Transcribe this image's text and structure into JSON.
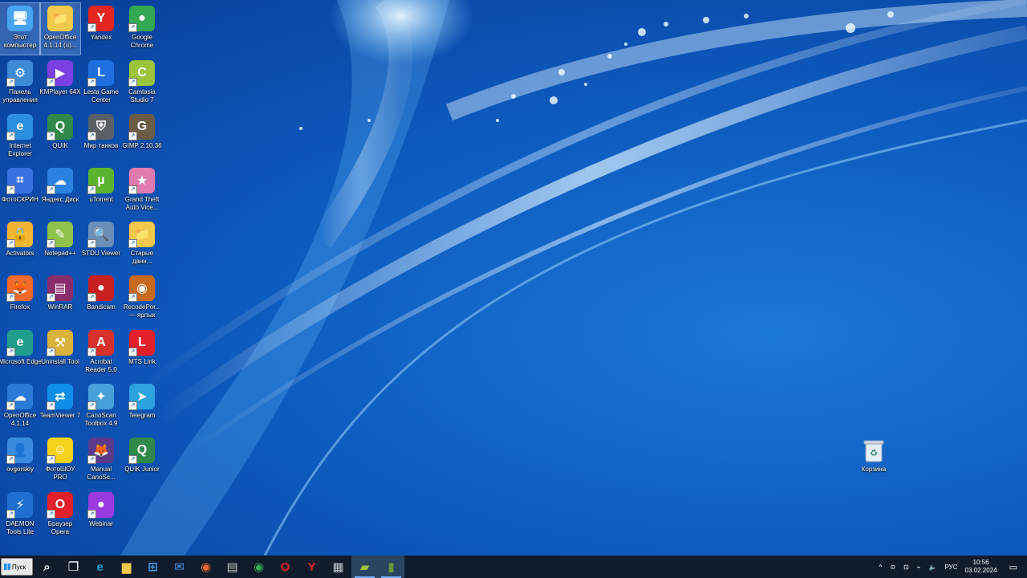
{
  "desktop_icons": [
    {
      "label": "Этот компьютер",
      "icon": "computer-icon",
      "color": "#4aa3f0",
      "glyph": "🖥",
      "selected": true
    },
    {
      "label": "OpenOffice 4.1.14 (u)...",
      "icon": "folder-icon",
      "color": "#f2c94c",
      "glyph": "📁",
      "selected": true
    },
    {
      "label": "Yandex",
      "icon": "yandex-browser-icon",
      "color": "#e52620",
      "glyph": "Y"
    },
    {
      "label": "Google Chrome",
      "icon": "chrome-icon",
      "color": "#34a853",
      "glyph": "●"
    },
    {
      "label": "Панель управления",
      "icon": "control-panel-icon",
      "color": "#3c8ad8",
      "glyph": "⚙"
    },
    {
      "label": "KMPlayer 64X",
      "icon": "kmplayer-icon",
      "color": "#7b3fe4",
      "glyph": "▶"
    },
    {
      "label": "Lesta Game Center",
      "icon": "lesta-icon",
      "color": "#1f6fe0",
      "glyph": "L"
    },
    {
      "label": "Camtasia Studio 7",
      "icon": "camtasia-icon",
      "color": "#9bc43a",
      "glyph": "C"
    },
    {
      "label": "Internet Explorer",
      "icon": "ie-icon",
      "color": "#2b8fe0",
      "glyph": "e"
    },
    {
      "label": "QUIK",
      "icon": "quik-icon",
      "color": "#2f8a4a",
      "glyph": "Q"
    },
    {
      "label": "Мир танков",
      "icon": "tanks-icon",
      "color": "#5a6066",
      "glyph": "⛨"
    },
    {
      "label": "GIMP 2.10.36",
      "icon": "gimp-icon",
      "color": "#6b5c45",
      "glyph": "G"
    },
    {
      "label": "ФотоСКРИН",
      "icon": "fotoscreen-icon",
      "color": "#3a6fe0",
      "glyph": "⌗"
    },
    {
      "label": "Яндекс.Диск",
      "icon": "yandex-disk-icon",
      "color": "#2a82e0",
      "glyph": "☁"
    },
    {
      "label": "uTorrent",
      "icon": "utorrent-icon",
      "color": "#5cb32e",
      "glyph": "µ"
    },
    {
      "label": "Grand Theft Auto Vice...",
      "icon": "gta-icon",
      "color": "#e07ab0",
      "glyph": "★"
    },
    {
      "label": "Activators",
      "icon": "lock-icon",
      "color": "#f2b632",
      "glyph": "🔒"
    },
    {
      "label": "Notepad++",
      "icon": "notepadpp-icon",
      "color": "#8fc24a",
      "glyph": "✎"
    },
    {
      "label": "STDU Viewer",
      "icon": "stdu-viewer-icon",
      "color": "#6a8fb8",
      "glyph": "🔍"
    },
    {
      "label": "Старые данн...",
      "icon": "folder-icon",
      "color": "#f2c94c",
      "glyph": "📁"
    },
    {
      "label": "Firefox",
      "icon": "firefox-icon",
      "color": "#f2692a",
      "glyph": "🦊"
    },
    {
      "label": "WinRAR",
      "icon": "winrar-icon",
      "color": "#8a2d6c",
      "glyph": "▤"
    },
    {
      "label": "Bandicam",
      "icon": "bandicam-icon",
      "color": "#c8201e",
      "glyph": "●"
    },
    {
      "label": "RecodePor... — ярлык",
      "icon": "recode-icon",
      "color": "#c86a1e",
      "glyph": "◉"
    },
    {
      "label": "Microsoft Edge",
      "icon": "edge-icon",
      "color": "#1f9e8c",
      "glyph": "e"
    },
    {
      "label": "Uninstall Tool",
      "icon": "uninstall-tool-icon",
      "color": "#d8b23a",
      "glyph": "⚒"
    },
    {
      "label": "Acrobat Reader 5.0",
      "icon": "acrobat-icon",
      "color": "#d8302a",
      "glyph": "A"
    },
    {
      "label": "MTS Link",
      "icon": "mts-link-icon",
      "color": "#e3202a",
      "glyph": "L"
    },
    {
      "label": "OpenOffice 4.1.14",
      "icon": "openoffice-icon",
      "color": "#2a7ad8",
      "glyph": "☁"
    },
    {
      "label": "TeamViewer 7",
      "icon": "teamviewer-icon",
      "color": "#0e8ee8",
      "glyph": "⇄"
    },
    {
      "label": "CanoScan Toolbox 4.9",
      "icon": "canoscan-icon",
      "color": "#48a0d8",
      "glyph": "✦"
    },
    {
      "label": "Telegram",
      "icon": "telegram-icon",
      "color": "#2aa3e0",
      "glyph": "➤"
    },
    {
      "label": "ovgorskiy",
      "icon": "user-folder-icon",
      "color": "#3a8ae0",
      "glyph": "👤"
    },
    {
      "label": "ФотоШОУ PRO",
      "icon": "fotoshow-icon",
      "color": "#f4d21a",
      "glyph": "☺"
    },
    {
      "label": "Manual CanoSc...",
      "icon": "manual-icon",
      "color": "#5a3a8a",
      "glyph": "🦊"
    },
    {
      "label": "QUIK Junior",
      "icon": "quik-junior-icon",
      "color": "#2f8a4a",
      "glyph": "Q"
    },
    {
      "label": "DAEMON Tools Lite",
      "icon": "daemon-tools-icon",
      "color": "#1f6fd0",
      "glyph": "⚡"
    },
    {
      "label": "Браузер Opera",
      "icon": "opera-icon",
      "color": "#e2202a",
      "glyph": "O"
    },
    {
      "label": "Webinar",
      "icon": "webinar-icon",
      "color": "#9a3ae0",
      "glyph": "●"
    }
  ],
  "recycle_bin": {
    "label": "Корзина",
    "icon": "recycle-bin-icon"
  },
  "taskbar": {
    "start_label": "Пуск",
    "apps": [
      {
        "name": "search",
        "icon": "search-icon",
        "glyph": "⌕",
        "color": "#ffffff"
      },
      {
        "name": "task-view",
        "icon": "task-view-icon",
        "glyph": "❐",
        "color": "#ffffff"
      },
      {
        "name": "edge",
        "icon": "edge-icon",
        "glyph": "e",
        "color": "#1fa0d8"
      },
      {
        "name": "explorer",
        "icon": "file-explorer-icon",
        "glyph": "▆",
        "color": "#f2c94c"
      },
      {
        "name": "store",
        "icon": "store-icon",
        "glyph": "⊞",
        "color": "#3a9ae8"
      },
      {
        "name": "mail",
        "icon": "mail-icon",
        "glyph": "✉",
        "color": "#3a9ae8"
      },
      {
        "name": "firefox",
        "icon": "firefox-icon",
        "glyph": "◉",
        "color": "#f2692a"
      },
      {
        "name": "winrar",
        "icon": "winrar-icon",
        "glyph": "▤",
        "color": "#c0c0c0"
      },
      {
        "name": "chrome",
        "icon": "chrome-icon",
        "glyph": "◉",
        "color": "#34a853"
      },
      {
        "name": "opera",
        "icon": "opera-icon",
        "glyph": "O",
        "color": "#e2202a"
      },
      {
        "name": "yandex",
        "icon": "yandex-browser-icon",
        "glyph": "Y",
        "color": "#e52620"
      },
      {
        "name": "calculator",
        "icon": "calculator-icon",
        "glyph": "▦",
        "color": "#c0c8d0"
      },
      {
        "name": "camtasia",
        "icon": "camtasia-icon",
        "glyph": "▰",
        "color": "#9bc43a",
        "active": true
      },
      {
        "name": "recorder",
        "icon": "recorder-app-icon",
        "glyph": "▮",
        "color": "#6a9a3a",
        "active": true
      }
    ],
    "tray": {
      "chevron": "^",
      "language": "РУС",
      "time": "10:56",
      "date": "03.02.2024"
    }
  }
}
